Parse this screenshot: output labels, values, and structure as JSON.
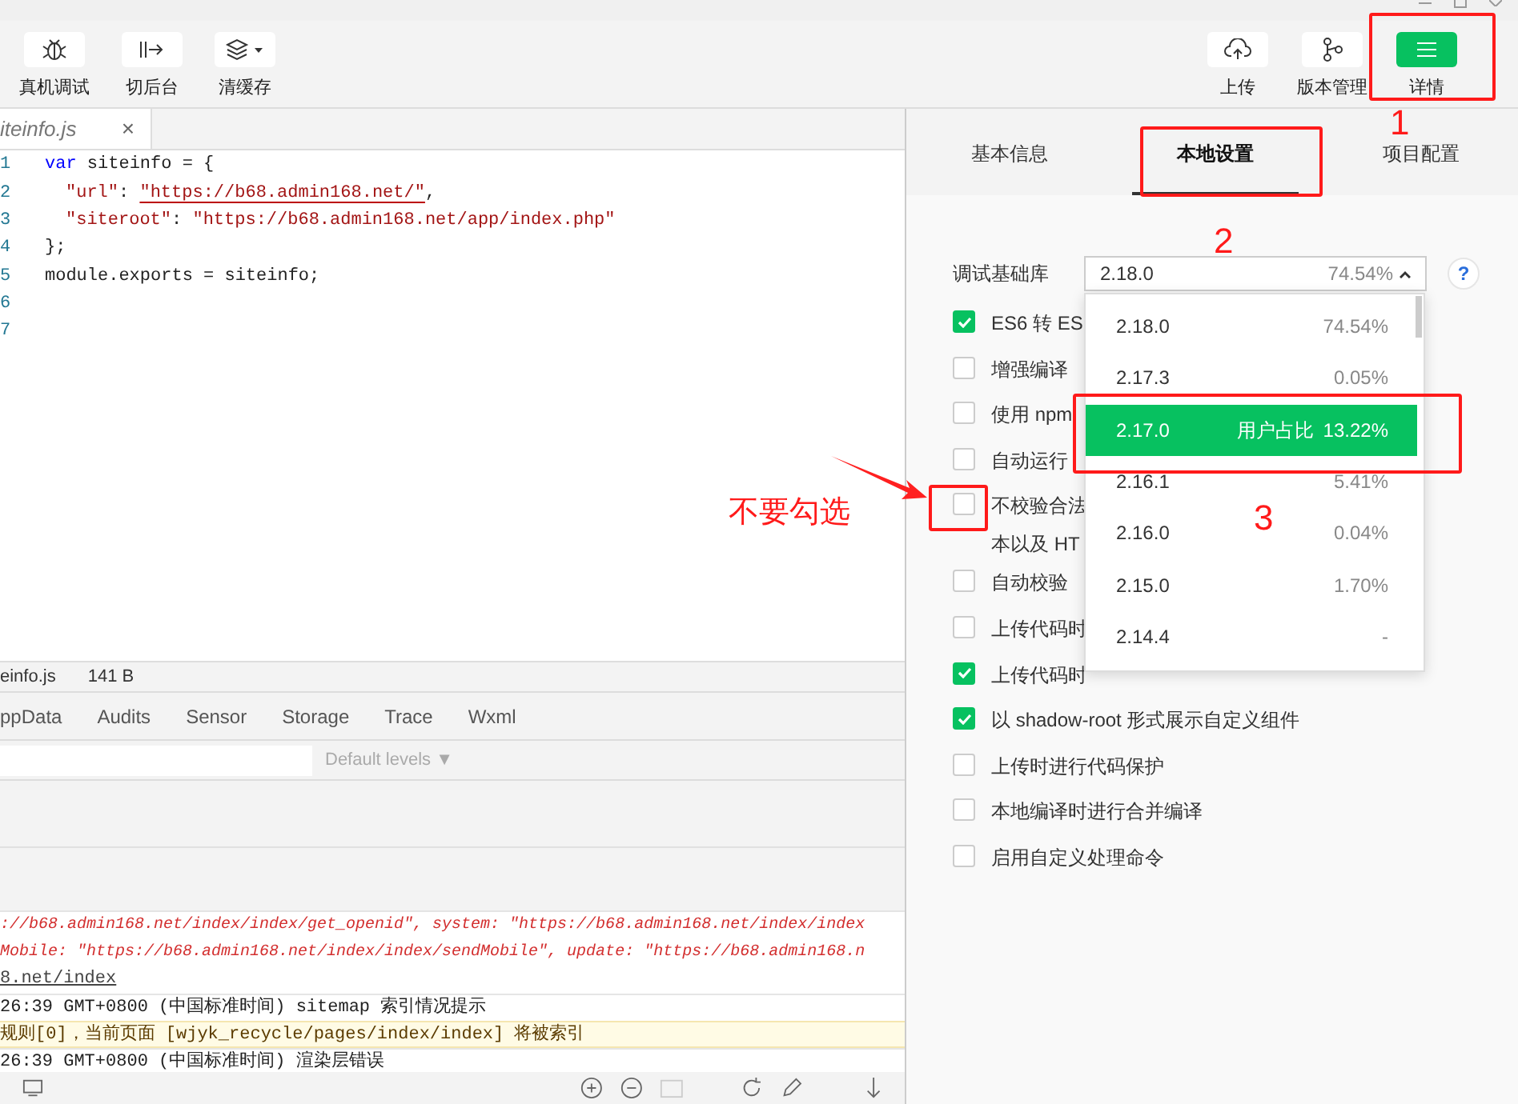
{
  "toolbar": {
    "left": [
      {
        "label": "真机调试"
      },
      {
        "label": "切后台"
      },
      {
        "label": "清缓存"
      }
    ],
    "right": [
      {
        "label": "上传",
        "selected": false
      },
      {
        "label": "版本管理",
        "selected": false
      },
      {
        "label": "详情",
        "selected": true
      }
    ]
  },
  "editor": {
    "tab": {
      "label": "iteinfo.js",
      "close": "×"
    },
    "lines": [
      {
        "number": "1",
        "tokens": [
          {
            "kind": "keyword",
            "text": "var"
          },
          {
            "kind": "plain",
            "text": " siteinfo = {"
          }
        ]
      },
      {
        "number": "2",
        "tokens": [
          {
            "kind": "key",
            "text": "\"url\""
          },
          {
            "kind": "plain",
            "text": ": "
          },
          {
            "kind": "string",
            "text": "\"https://b68.admin168.net/\"",
            "flagged": true
          },
          {
            "kind": "plain",
            "text": ","
          }
        ]
      },
      {
        "number": "3",
        "tokens": [
          {
            "kind": "key",
            "text": "\"siteroot\""
          },
          {
            "kind": "plain",
            "text": ": "
          },
          {
            "kind": "string",
            "text": "\"https://b68.admin168.net/app/index.php\"",
            "flagged": false
          }
        ]
      },
      {
        "number": "4",
        "tokens": [
          {
            "kind": "plain",
            "text": "};"
          }
        ]
      },
      {
        "number": "5",
        "tokens": [
          {
            "kind": "plain",
            "text": "module.exports = siteinfo;"
          }
        ]
      },
      {
        "number": "6"
      },
      {
        "number": "7"
      }
    ]
  },
  "status": {
    "file": "einfo.js",
    "size": "141 B"
  },
  "devtools": {
    "tabs": [
      "ppData",
      "Audits",
      "Sensor",
      "Storage",
      "Trace",
      "Wxml"
    ],
    "levels": "Default levels ▼"
  },
  "console": [
    {
      "kind": "error",
      "text": "://b68.admin168.net/index/index/get_openid\", system: \"https://b68.admin168.net/index/index"
    },
    {
      "kind": "error",
      "text": "Mobile: \"https://b68.admin168.net/index/index/sendMobile\", update: \"https://b68.admin168.n"
    },
    {
      "kind": "link",
      "text": "8.net/index"
    },
    {
      "kind": "info",
      "text": "26:39 GMT+0800 (中国标准时间) sitemap 索引情况提示"
    },
    {
      "kind": "warning",
      "text": "规则[0]，当前页面 [wjyk_recycle/pages/index/index] 将被索引"
    },
    {
      "kind": "info",
      "text": "26:39 GMT+0800 (中国标准时间) 渲染层错误"
    }
  ],
  "details": {
    "tabs": [
      {
        "label": "基本信息",
        "selected": false
      },
      {
        "label": "本地设置",
        "selected": true
      },
      {
        "label": "项目配置",
        "selected": false
      }
    ],
    "library": {
      "label": "调试基础库",
      "value": "2.18.0",
      "share": "74.54%",
      "help": "?"
    },
    "options": [
      {
        "version": "2.18.0",
        "share": "74.54%",
        "selected": false
      },
      {
        "version": "2.17.3",
        "share": "0.05%",
        "selected": false
      },
      {
        "version": "2.17.0",
        "hint": "用户占比",
        "share": "13.22%",
        "selected": true
      },
      {
        "version": "2.16.1",
        "share": "5.41%",
        "selected": false
      },
      {
        "version": "2.16.0",
        "share": "0.04%",
        "selected": false
      },
      {
        "version": "2.15.0",
        "share": "1.70%",
        "selected": false
      },
      {
        "version": "2.14.4",
        "share": "-",
        "selected": false
      }
    ],
    "checkboxes": [
      {
        "lines": [
          "ES6 转 ES"
        ],
        "checked": true
      },
      {
        "lines": [
          "增强编译"
        ],
        "checked": false
      },
      {
        "lines": [
          "使用 npm"
        ],
        "checked": false
      },
      {
        "lines": [
          "自动运行"
        ],
        "checked": false
      },
      {
        "lines": [
          "不校验合法",
          "本以及 HT"
        ],
        "checked": false
      },
      {
        "lines": [
          "自动校验"
        ],
        "checked": false
      },
      {
        "lines": [
          "上传代码时"
        ],
        "checked": false
      },
      {
        "lines": [
          "上传代码时"
        ],
        "checked": true
      },
      {
        "lines": [
          "以 shadow-root 形式展示自定义组件"
        ],
        "checked": true
      },
      {
        "lines": [
          "上传时进行代码保护"
        ],
        "checked": false
      },
      {
        "lines": [
          "本地编译时进行合并编译"
        ],
        "checked": false
      },
      {
        "lines": [
          "启用自定义处理命令"
        ],
        "checked": false
      }
    ]
  },
  "annotations": [
    {
      "text": "1"
    },
    {
      "text": "2"
    },
    {
      "text": "3"
    },
    {
      "text": "不要勾选"
    }
  ]
}
